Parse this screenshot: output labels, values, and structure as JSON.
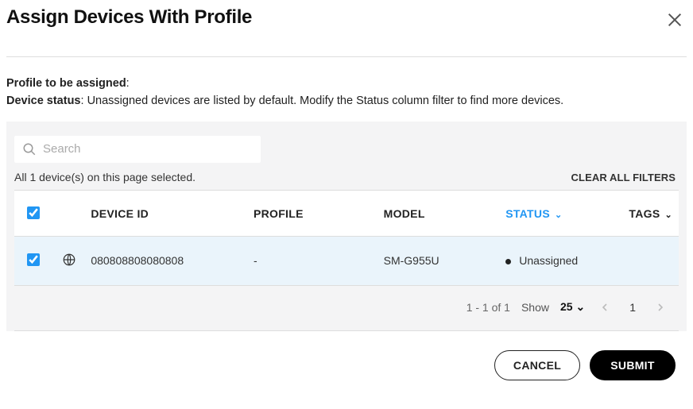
{
  "dialog": {
    "title": "Assign Devices With Profile"
  },
  "info": {
    "profile_label": "Profile to be assigned",
    "profile_value": "",
    "status_label": "Device status",
    "status_text": "Unassigned devices are listed by default. Modify the Status column filter to find more devices."
  },
  "search": {
    "placeholder": "Search",
    "value": ""
  },
  "selection_text": "All 1 device(s) on this page selected.",
  "clear_filters": "CLEAR ALL FILTERS",
  "columns": {
    "device_id": "DEVICE ID",
    "profile": "PROFILE",
    "model": "MODEL",
    "status": "STATUS",
    "tags": "TAGS"
  },
  "rows": [
    {
      "checked": true,
      "device_id": "080808808080808",
      "profile": "-",
      "model": "SM-G955U",
      "status": "Unassigned",
      "tags": ""
    }
  ],
  "pager": {
    "range": "1 - 1 of 1",
    "show_label": "Show",
    "page_size": "25",
    "current_page": "1"
  },
  "buttons": {
    "cancel": "CANCEL",
    "submit": "SUBMIT"
  }
}
